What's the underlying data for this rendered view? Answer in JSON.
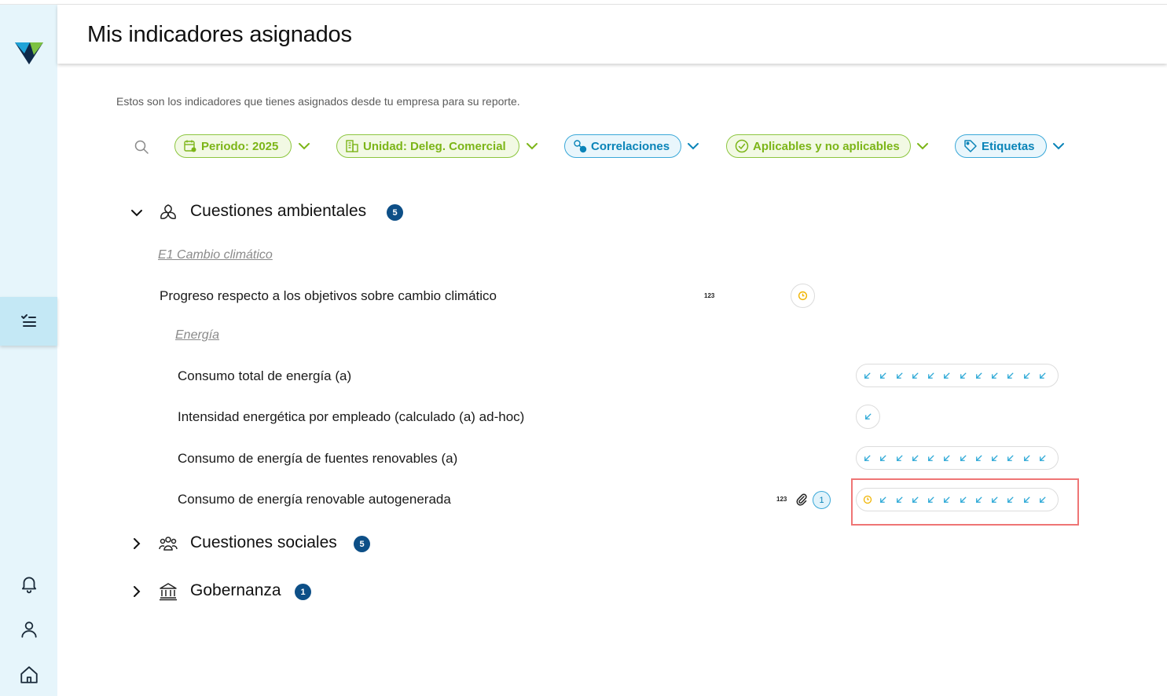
{
  "header": {
    "title": "Mis indicadores asignados"
  },
  "subtitle": "Estos son los indicadores que tienes asignados desde tu empresa para su reporte.",
  "filters": {
    "periodo": "Periodo: 2025",
    "unidad": "Unidad: Deleg. Comercial",
    "correlaciones": "Correlaciones",
    "aplicables": "Aplicables y no aplicables",
    "etiquetas": "Etiquetas"
  },
  "sections": {
    "ambientales": {
      "title": "Cuestiones ambientales",
      "count": "5",
      "expanded": true
    },
    "sociales": {
      "title": "Cuestiones sociales",
      "count": "5",
      "expanded": false
    },
    "gobernanza": {
      "title": "Gobernanza",
      "count": "1",
      "expanded": false
    }
  },
  "ambientales": {
    "group_e1": "E1 Cambio climático",
    "progreso": {
      "label": "Progreso respecto a los objetivos sobre cambio climático",
      "type_tag": "123"
    },
    "group_energia": "Energía",
    "consumo_total": {
      "label": "Consumo total de energía (a)",
      "periods": 12
    },
    "intensidad": {
      "label": "Intensidad energética por empleado (calculado (a) ad-hoc)",
      "periods": 1
    },
    "renovables": {
      "label": "Consumo de energía de fuentes renovables (a)",
      "periods": 12
    },
    "autogenerada": {
      "label": "Consumo de energía renovable autogenerada",
      "type_tag": "123",
      "attachments_count": "1",
      "periods": 12
    }
  },
  "colors": {
    "accent_blue": "#0a84b8",
    "accent_green": "#7cb518",
    "badge_navy": "#0d4f87",
    "pending_yellow": "#f0b400",
    "sidebar_bg": "#e6f5fb",
    "highlight_red": "#ef7575"
  },
  "icons": {
    "sidebar": [
      "logo",
      "checklist-icon",
      "bell-icon",
      "user-icon",
      "home-icon"
    ],
    "status": [
      "arrow-down-left-icon",
      "clock-icon"
    ]
  }
}
